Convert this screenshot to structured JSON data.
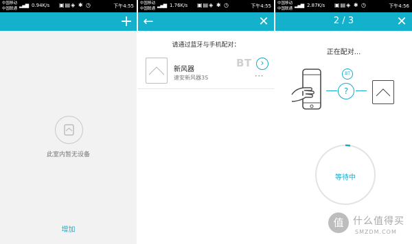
{
  "status_left": {
    "carrier1": "中国移动",
    "carrier2": "中国联通",
    "speed": "0.94K/s",
    "time": "下午4:55"
  },
  "status_mid": {
    "carrier1": "中国移动",
    "carrier2": "中国联通",
    "speed": "1.76K/s",
    "time": "下午4:55"
  },
  "status_right": {
    "carrier1": "中国移动",
    "carrier2": "中国联通",
    "speed": "2.87K/s",
    "time": "下午4:56"
  },
  "screen1": {
    "empty_text": "此室内暂无设备",
    "add_label": "增加",
    "add_icon": "+"
  },
  "screen2": {
    "back_icon": "←",
    "close_icon": "✕",
    "prompt": "请通过蓝牙与手机配对：",
    "device": {
      "name": "新风器",
      "model": "速安新风器3S",
      "badge": "BT",
      "arrow": "›",
      "dots": "• • •"
    }
  },
  "screen3": {
    "step": "2 / 3",
    "close_icon": "✕",
    "status": "正在配对...",
    "bt_label": "BT",
    "question": "?",
    "waiting": "等待中"
  },
  "watermark": {
    "brand": "什么值得买",
    "domain": "SMZDM.COM",
    "logo": "值"
  },
  "colors": {
    "accent": "#14b1cc",
    "arrow": "#17a9c8"
  }
}
